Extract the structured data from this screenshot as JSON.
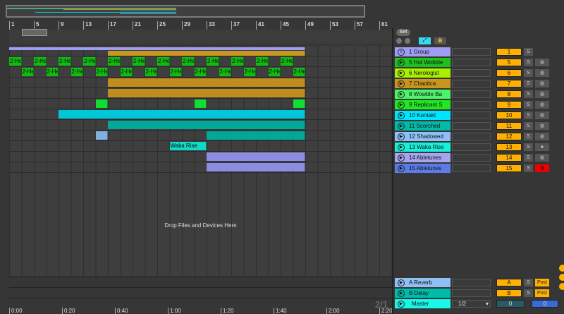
{
  "ruler": {
    "bars": [
      "1",
      "5",
      "9",
      "13",
      "17",
      "21",
      "25",
      "29",
      "33",
      "37",
      "41",
      "45",
      "49",
      "53",
      "57",
      "61"
    ]
  },
  "time_ruler": [
    "0:00",
    "0:20",
    "0:40",
    "1:00",
    "1:20",
    "1:40",
    "2:00",
    "2:20"
  ],
  "controls": {
    "set_label": "Set",
    "follow_icon": "pencil-icon",
    "lock_icon": "lock-icon"
  },
  "drop_hint": "Drop Files and Devices Here",
  "page_indicator": "2/1",
  "tracks": [
    {
      "name": "1 Group",
      "color": "#9e9ef5",
      "num": "1",
      "icon": "group-icon",
      "rec": false,
      "clips": [
        {
          "s": 1,
          "e": 49,
          "c": "#9e9ef5",
          "label": ""
        },
        {
          "s": 17,
          "e": 49,
          "c": "#c8961e",
          "label": ""
        }
      ]
    },
    {
      "name": "5 Hot Wobble",
      "color": "#1dc21d",
      "num": "5",
      "rec": true,
      "clips": "pattern_a"
    },
    {
      "name": "6 Nerologist",
      "color": "#a8f000",
      "num": "6",
      "rec": true,
      "clips": "pattern_b"
    },
    {
      "name": "7 Chaotica",
      "color": "#c8961e",
      "num": "7",
      "rec": true,
      "clips": [
        {
          "s": 17,
          "e": 49,
          "c": "#c08c1e",
          "label": ""
        }
      ]
    },
    {
      "name": "8 Wowble Ba",
      "color": "#4af56a",
      "num": "8",
      "rec": true,
      "clips": [
        {
          "s": 17,
          "e": 49,
          "c": "#c08c1e",
          "label": ""
        }
      ]
    },
    {
      "name": "9 Replicant S",
      "color": "#22e822",
      "num": "9",
      "rec": true,
      "clips": [
        {
          "s": 15,
          "e": 17,
          "c": "#11dd33",
          "label": ""
        },
        {
          "s": 31,
          "e": 33,
          "c": "#11dd33",
          "label": ""
        },
        {
          "s": 47,
          "e": 49,
          "c": "#11dd33",
          "label": ""
        }
      ]
    },
    {
      "name": "10 Kontakt",
      "color": "#00e5ff",
      "num": "10",
      "rec": true,
      "clips": [
        {
          "s": 9,
          "e": 49,
          "c": "#00c8d8",
          "label": ""
        }
      ]
    },
    {
      "name": "11 Scorched",
      "color": "#00bba8",
      "num": "11",
      "rec": true,
      "clips": [
        {
          "s": 17,
          "e": 49,
          "c": "#00a898",
          "label": ""
        }
      ]
    },
    {
      "name": "12 Shadowed",
      "color": "#8fc0f5",
      "num": "12",
      "rec": true,
      "clips": [
        {
          "s": 15,
          "e": 17,
          "c": "#7fb0e0",
          "label": ""
        },
        {
          "s": 33,
          "e": 49,
          "c": "#00a898",
          "label": ""
        }
      ]
    },
    {
      "name": "13 Waka Rise",
      "color": "#18f0d8",
      "num": "13",
      "rec": true,
      "rec_white": true,
      "clips": [
        {
          "s": 27,
          "e": 33,
          "c": "#12d8c8",
          "label": "Waka Rise"
        }
      ]
    },
    {
      "name": "14 Abletunes",
      "color": "#a4a4f0",
      "num": "14",
      "rec": true,
      "clips": [
        {
          "s": 33,
          "e": 49,
          "c": "#8c8ce0",
          "label": ""
        }
      ]
    },
    {
      "name": "15 Abletunes",
      "color": "#5b7ce8",
      "num": "15",
      "rec": true,
      "rec_armed": true,
      "clips": [
        {
          "s": 33,
          "e": 49,
          "c": "#8c8ce0",
          "label": ""
        }
      ]
    }
  ],
  "clip_label": "2-He",
  "returns": [
    {
      "name": "A Reverb",
      "color": "#8fc0f5",
      "num": "A",
      "post": "Post"
    },
    {
      "name": "B Delay",
      "color": "#00bba8",
      "num": "B",
      "post": "Post"
    }
  ],
  "master": {
    "name": "Master",
    "color": "#18f8e8",
    "quantize": "1/2",
    "value_a": "0",
    "value_b": "0"
  },
  "solo_label": "S",
  "colors": {
    "clip_green": "#11bb11",
    "accent": "#ffb000",
    "armed": "#ee0000"
  }
}
